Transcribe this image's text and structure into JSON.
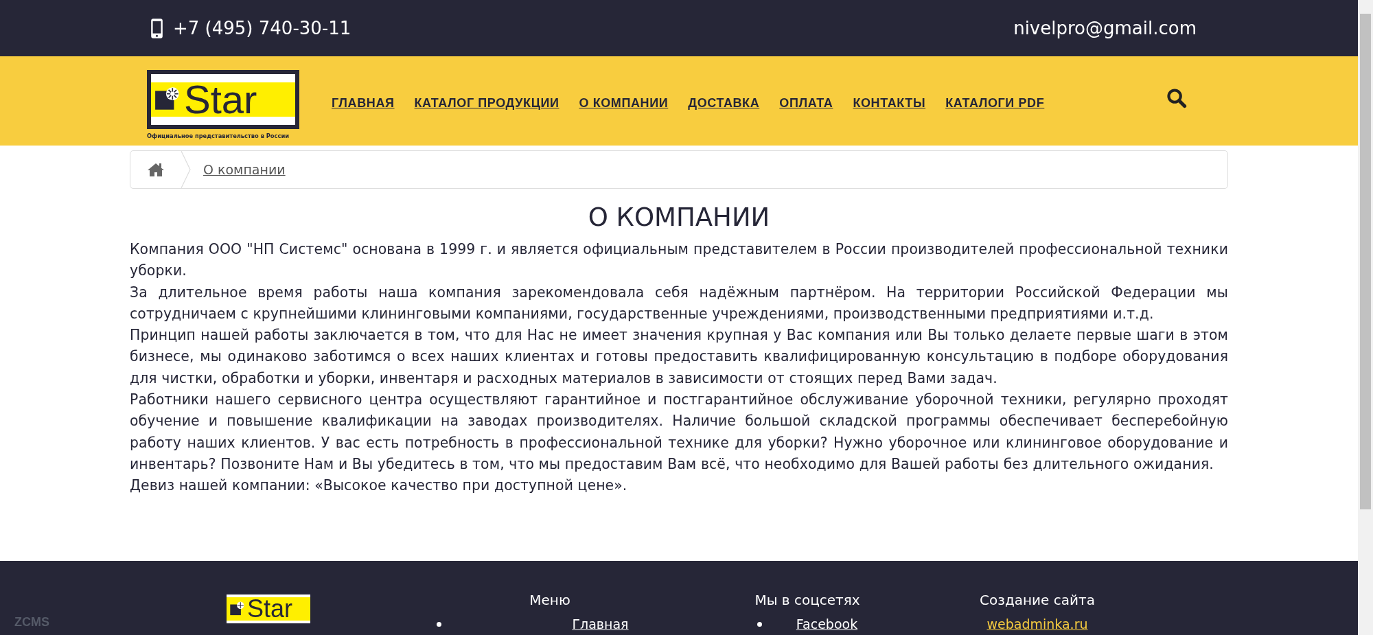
{
  "topbar": {
    "phone": "+7 (495) 740-30-11",
    "email": "nivelpro@gmail.com"
  },
  "logo": {
    "word": "Star",
    "tagline": "Официальное представительство в России"
  },
  "nav": [
    {
      "label": "ГЛАВНАЯ"
    },
    {
      "label": "КАТАЛОГ ПРОДУКЦИИ"
    },
    {
      "label": "О КОМПАНИИ"
    },
    {
      "label": "ДОСТАВКА"
    },
    {
      "label": "ОПЛАТА"
    },
    {
      "label": "КОНТАКТЫ"
    },
    {
      "label": "КАТАЛОГИ PDF"
    }
  ],
  "breadcrumb": [
    "О компании"
  ],
  "title": "О КОМПАНИИ",
  "paragraphs": [
    "Компания ООО \"НП Системс\" основана в 1999 г. и является официальным представителем в России  производителей профессиональной техники уборки.",
    "За длительное время работы наша компания зарекомендовала себя надёжным партнёром. На территории Российской Федерации мы сотрудничаем с крупнейшими клининговыми компаниями, государственные учреждениями, производственными предприятиями и.т.д.",
    "Принцип нашей работы заключается в том, что для Нас не имеет значения крупная у Вас компания или Вы только делаете первые шаги в этом бизнесе, мы одинаково заботимся о всех наших клиентах и готовы предоставить квалифицированную консультацию в подборе оборудования для чистки, обработки и уборки, инвентаря и расходных материалов в зависимости от стоящих перед Вами задач.",
    "Работники нашего сервисного центра осуществляют гарантийное и постгарантийное обслуживание уборочной техники, регулярно проходят обучение и повышение квалификации на заводах производителях. Наличие большой складской программы обеспечивает бесперебойную работу наших клиентов. У вас есть потребность в профессиональной технике для уборки? Нужно уборочное или клининговое оборудование и инвентарь? Позвоните Нам и Вы убедитесь в том, что мы предоставим Вам всё, что необходимо для Вашей работы без длительного ожидания.",
    "Девиз нашей компании: «Высокое качество при доступной цене»."
  ],
  "footer": {
    "badge": "ZCMS",
    "logo_word": "Star",
    "columns": [
      {
        "heading": "Меню",
        "kind": "list",
        "links": [
          "Главная"
        ]
      },
      {
        "heading": "Мы в соцсетях",
        "kind": "list",
        "links": [
          "Facebook"
        ]
      },
      {
        "heading": "Создание сайта",
        "kind": "plain",
        "links": [
          "webadminka.ru"
        ]
      }
    ]
  }
}
